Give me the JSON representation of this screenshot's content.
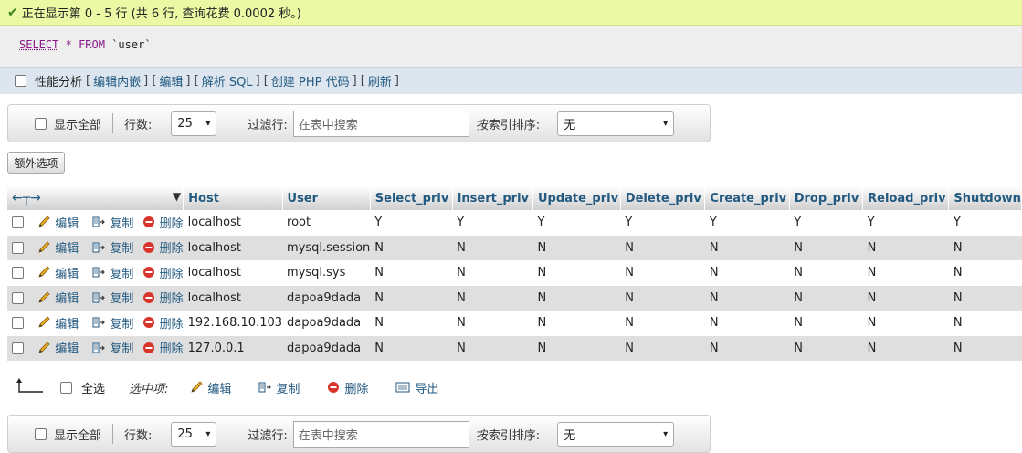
{
  "status": {
    "message": "正在显示第 0 - 5 行 (共 6 行, 查询花费 0.0002 秒。)"
  },
  "sql": {
    "select": "SELECT",
    "star": "*",
    "from": "FROM",
    "table": "`user`"
  },
  "query_options": {
    "profiling": "性能分析",
    "links": [
      "编辑内嵌",
      "编辑",
      "解析 SQL",
      "创建 PHP 代码",
      "刷新"
    ]
  },
  "nav_top": {
    "show_all": "显示全部",
    "rows_label": "行数:",
    "rows_value": "25",
    "filter_label": "过滤行:",
    "filter_placeholder": "在表中搜索",
    "sort_label": "按索引排序:",
    "sort_value": "无"
  },
  "extra_options": "额外选项",
  "table": {
    "columns": [
      "Host",
      "User",
      "Select_priv",
      "Insert_priv",
      "Update_priv",
      "Delete_priv",
      "Create_priv",
      "Drop_priv",
      "Reload_priv",
      "Shutdown"
    ],
    "row_actions": {
      "edit": "编辑",
      "copy": "复制",
      "delete": "删除"
    },
    "rows": [
      [
        "localhost",
        "root",
        "Y",
        "Y",
        "Y",
        "Y",
        "Y",
        "Y",
        "Y",
        "Y"
      ],
      [
        "localhost",
        "mysql.session",
        "N",
        "N",
        "N",
        "N",
        "N",
        "N",
        "N",
        "N"
      ],
      [
        "localhost",
        "mysql.sys",
        "N",
        "N",
        "N",
        "N",
        "N",
        "N",
        "N",
        "N"
      ],
      [
        "localhost",
        "dapoa9dada",
        "N",
        "N",
        "N",
        "N",
        "N",
        "N",
        "N",
        "N"
      ],
      [
        "192.168.10.103",
        "dapoa9dada",
        "N",
        "N",
        "N",
        "N",
        "N",
        "N",
        "N",
        "N"
      ],
      [
        "127.0.0.1",
        "dapoa9dada",
        "N",
        "N",
        "N",
        "N",
        "N",
        "N",
        "N",
        "N"
      ]
    ]
  },
  "bulk": {
    "select_all": "全选",
    "with_selected": "选中项:",
    "edit": "编辑",
    "copy": "复制",
    "delete": "删除",
    "export": "导出"
  },
  "nav_bottom": {
    "show_all": "显示全部",
    "rows_label": "行数:",
    "rows_value": "25",
    "filter_label": "过滤行:",
    "filter_placeholder": "在表中搜索",
    "sort_label": "按索引排序:",
    "sort_value": "无"
  }
}
